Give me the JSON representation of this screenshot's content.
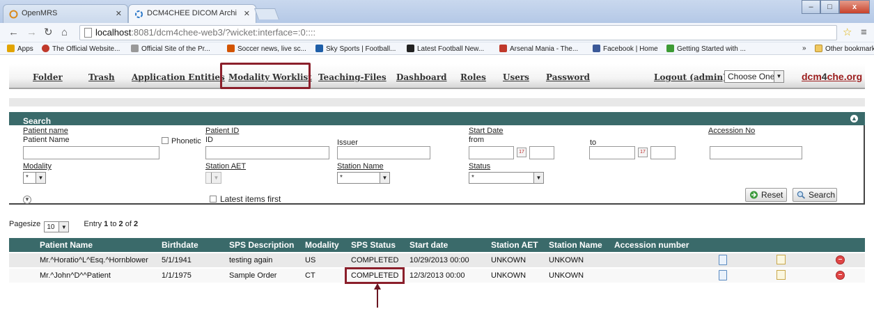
{
  "browser": {
    "tabs": [
      {
        "label": "OpenMRS",
        "active": false
      },
      {
        "label": "DCM4CHEE DICOM Archi",
        "active": true
      }
    ],
    "window_buttons": {
      "minimize": "–",
      "maximize": "□",
      "close": "x"
    },
    "url": {
      "host": "localhost",
      "rest": ":8081/dcm4chee-web3/?wicket:interface=:0::::"
    },
    "bookmarks": [
      {
        "label": "Apps",
        "color": "#e2a400"
      },
      {
        "label": "The Official Website...",
        "color": "#c0392b"
      },
      {
        "label": "Official Site of the Pr...",
        "color": "#888888"
      },
      {
        "label": "Soccer news, live sc...",
        "color": "#d35400"
      },
      {
        "label": "Sky Sports | Football...",
        "color": "#1f5fa8"
      },
      {
        "label": "Latest Football New...",
        "color": "#222222"
      },
      {
        "label": "Arsenal Mania - The...",
        "color": "#c0392b"
      },
      {
        "label": "Facebook | Home",
        "color": "#3b5998"
      },
      {
        "label": "Getting Started with ...",
        "color": "#3d9b35"
      }
    ],
    "bookmarks_overflow": "»",
    "other_bookmarks": "Other bookmarks"
  },
  "nav": {
    "items": [
      "Folder",
      "Trash",
      "Application Entities",
      "Modality Worklist",
      "Teaching-Files",
      "Dashboard",
      "Roles",
      "Users",
      "Password"
    ],
    "active": "Modality Worklist",
    "logout": "Logout (admin)",
    "language_select": "Choose One",
    "brand_pre": "dcm",
    "brand_mid": "4",
    "brand_post": "che.org"
  },
  "search": {
    "title": "Search",
    "patient_name_link": "Patient name",
    "patient_name_label": "Patient Name",
    "phonetic_label": "Phonetic",
    "patient_id_link": "Patient ID",
    "id_label": "ID",
    "issuer_label": "Issuer",
    "start_date_link": "Start Date",
    "from_label": "from",
    "to_label": "to",
    "accession_link": "Accession No",
    "modality_link": "Modality",
    "modality_value": "*",
    "station_aet_link": "Station AET",
    "station_name_link": "Station Name",
    "station_name_value": "*",
    "status_link": "Status",
    "status_value": "*",
    "latest_first_label": "Latest items first",
    "reset_button": "Reset",
    "search_button": "Search"
  },
  "pager": {
    "pagesize_label": "Pagesize",
    "pagesize_value": "10",
    "entry_prefix": "Entry ",
    "entry_from": "1",
    "entry_to_word": " to ",
    "entry_to": "2",
    "entry_of_word": " of ",
    "entry_total": "2"
  },
  "table": {
    "columns": [
      "Patient Name",
      "Birthdate",
      "SPS Description",
      "Modality",
      "SPS Status",
      "Start date",
      "Station AET",
      "Station Name",
      "Accession number"
    ],
    "rows": [
      [
        "Mr.^Horatio^L^Esq.^Hornblower",
        "5/1/1941",
        "testing again",
        "US",
        "COMPLETED",
        "10/29/2013 00:00",
        "UNKOWN",
        "UNKOWN",
        ""
      ],
      [
        "Mr.^John^D^^Patient",
        "1/1/1975",
        "Sample Order",
        "CT",
        "COMPLETED",
        "12/3/2013 00:00",
        "UNKOWN",
        "UNKOWN",
        ""
      ]
    ]
  },
  "colors": {
    "header_teal": "#3a6a6a",
    "highlight": "#8b1f2b",
    "brand_red": "#9b1c1c"
  }
}
